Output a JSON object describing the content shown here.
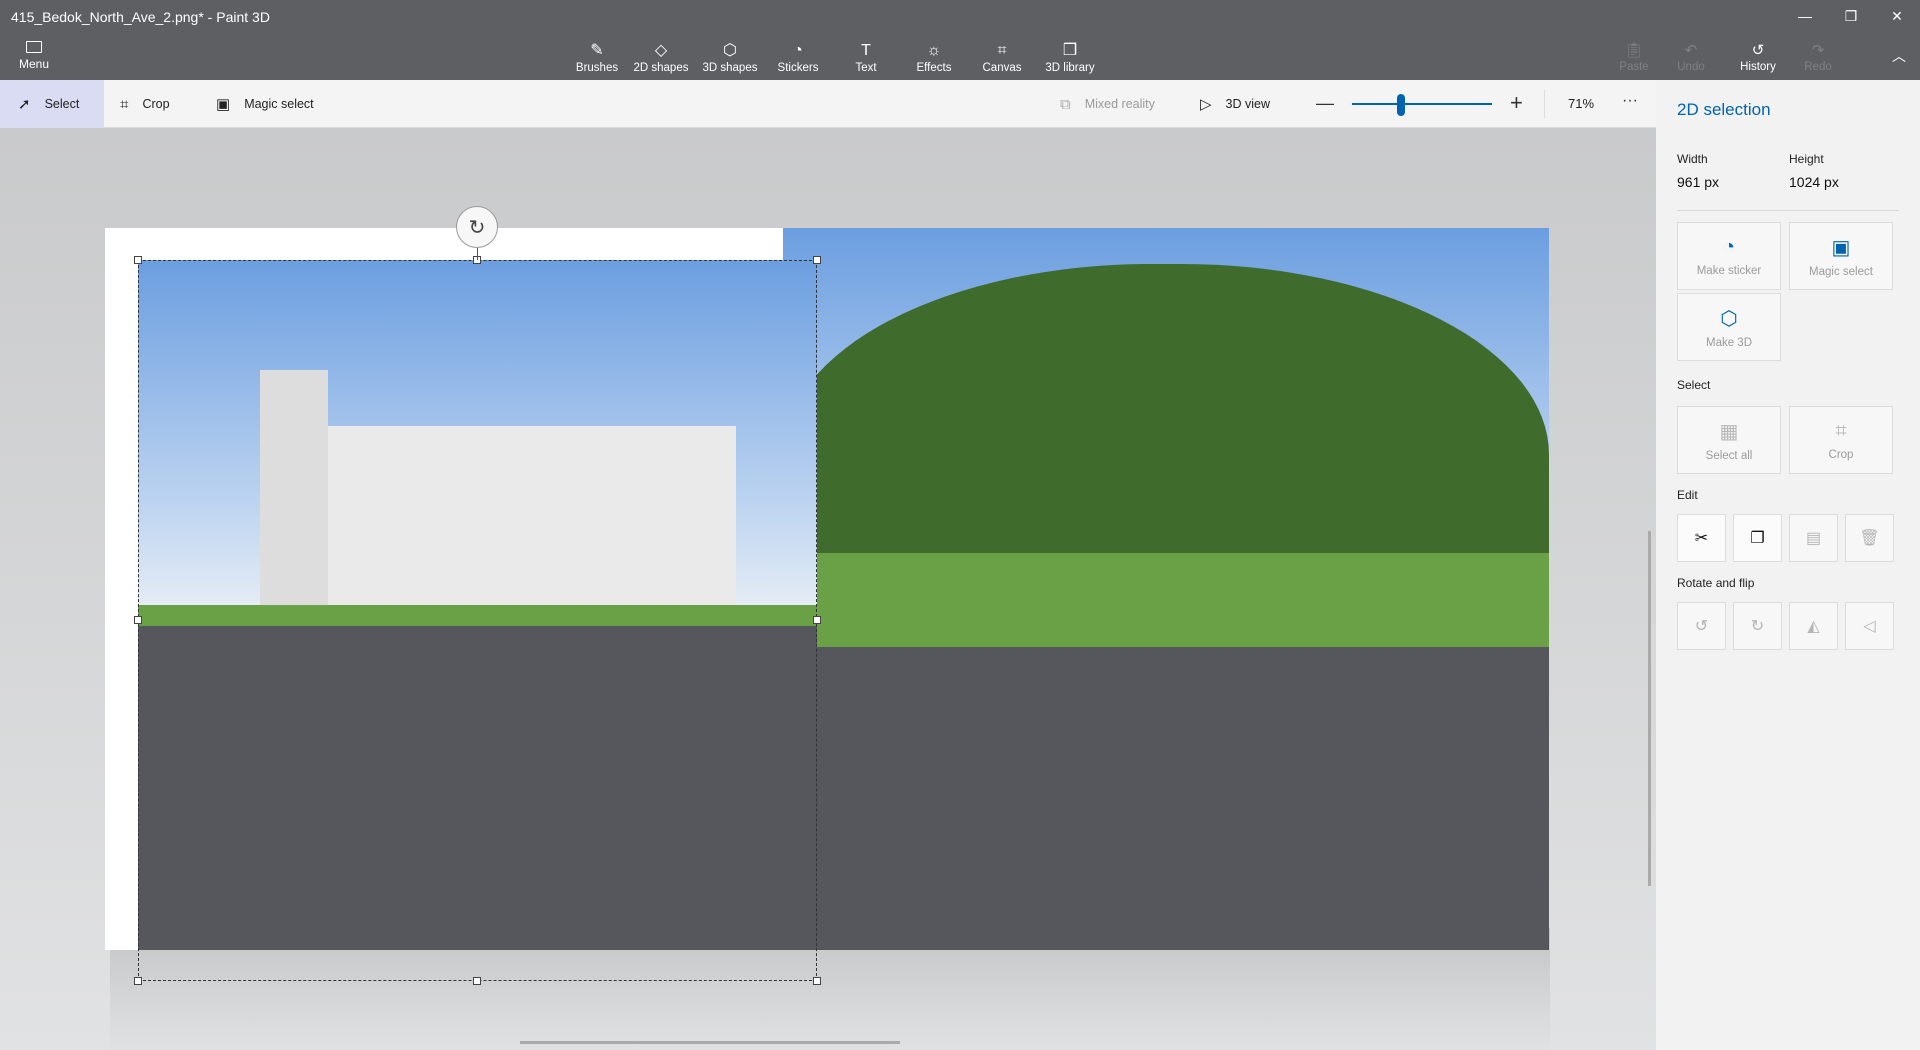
{
  "window": {
    "title": "415_Bedok_North_Ave_2.png* - Paint 3D",
    "controls": [
      "—",
      "❐",
      "✕"
    ]
  },
  "ribbon": {
    "menu_label": "Menu",
    "tools": [
      "Brushes",
      "2D shapes",
      "3D shapes",
      "Stickers",
      "Text",
      "Effects",
      "Canvas",
      "3D library"
    ],
    "right_tools": [
      "Paste",
      "Undo",
      "History",
      "Redo"
    ]
  },
  "subbar": {
    "select": "Select",
    "crop": "Crop",
    "magic_select": "Magic select",
    "mixed_reality": "Mixed reality",
    "view_3d": "3D view",
    "zoom": "71%",
    "zoom_level": 0.35
  },
  "panel": {
    "title": "2D selection",
    "width_label": "Width",
    "width_value": "961 px",
    "height_label": "Height",
    "height_value": "1024 px",
    "make_sticker": "Make sticker",
    "magic_select": "Magic select",
    "make_3d": "Make 3D",
    "section_select": "Select",
    "select_all": "Select all",
    "crop": "Crop",
    "section_edit": "Edit",
    "section_rotate": "Rotate and flip"
  },
  "colors": {
    "accent": "#0063b1",
    "titlebar": "#5d5f63"
  }
}
